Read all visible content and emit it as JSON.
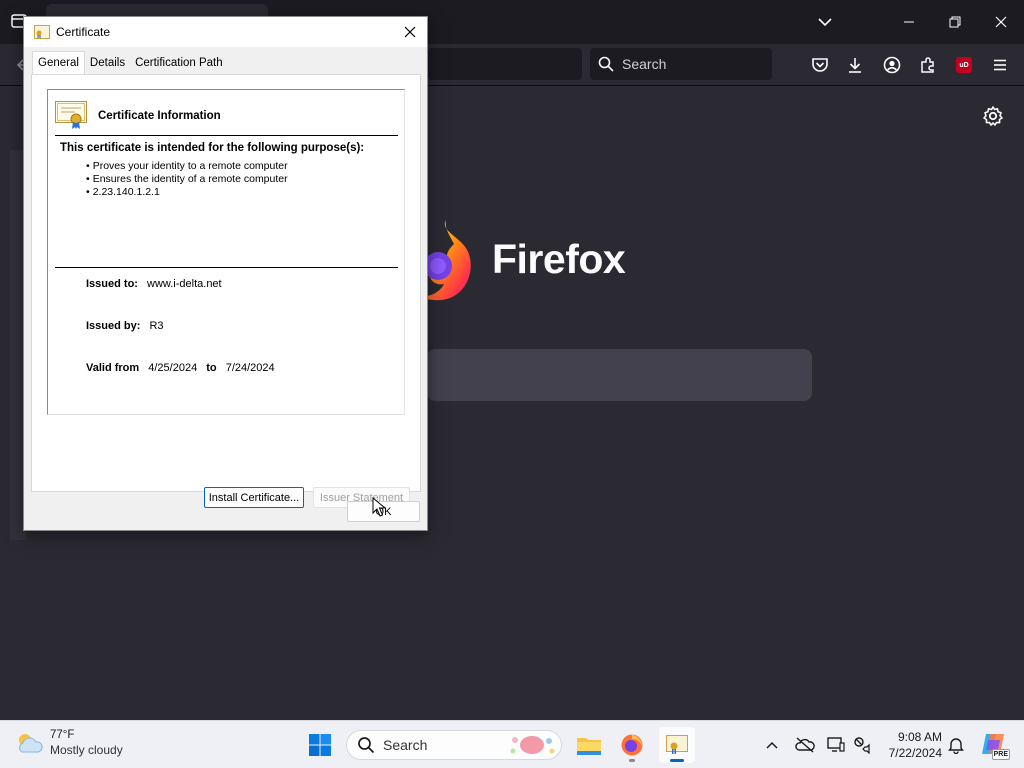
{
  "browser": {
    "searchbar_placeholder": "Search",
    "brand_name": "Firefox",
    "ublock_badge": "uD"
  },
  "dialog": {
    "title": "Certificate",
    "tabs": [
      "General",
      "Details",
      "Certification Path"
    ],
    "active_tab": "General",
    "info_title": "Certificate Information",
    "purpose_heading": "This certificate is intended for the following purpose(s):",
    "purposes": [
      "Proves your identity to a remote computer",
      "Ensures the identity of a remote computer",
      "2.23.140.1.2.1"
    ],
    "issued_to_label": "Issued to:",
    "issued_to": "www.i-delta.net",
    "issued_by_label": "Issued by:",
    "issued_by": "R3",
    "valid_from_label": "Valid from",
    "valid_from": "4/25/2024",
    "valid_to_label": "to",
    "valid_to": "7/24/2024",
    "install_button": "Install Certificate...",
    "issuer_button": "Issuer Statement",
    "ok_button": "OK"
  },
  "taskbar": {
    "weather_temp": "77°F",
    "weather_desc": "Mostly cloudy",
    "search_placeholder": "Search",
    "time": "9:08 AM",
    "date": "7/22/2024",
    "copilot_badge": "PRE"
  },
  "colors": {
    "accent": "#0067c0",
    "firefox_bg": "#2b2a33",
    "tabstrip_bg": "#1c1b22",
    "dialog_bg": "#f0f0f0"
  }
}
